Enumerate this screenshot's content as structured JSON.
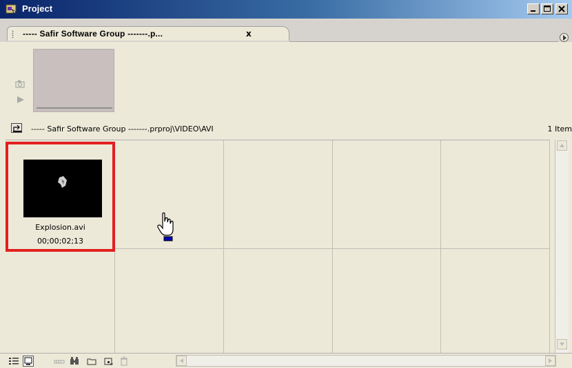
{
  "window": {
    "title": "Project",
    "icons": [
      "app-icon",
      "minimize-icon",
      "maximize-icon",
      "close-icon"
    ]
  },
  "tab": {
    "label": "----- Safir Software Group -------.p...",
    "close": "x"
  },
  "path": {
    "text": "----- Safir Software Group -------.prproj\\VIDEO\\AVI",
    "item_count": "1 Item"
  },
  "clips": [
    {
      "name": "Explosion.avi",
      "duration": "00;00;02;13",
      "selected": true
    }
  ],
  "toolbar": {
    "icons": [
      "list-view-icon",
      "icon-view-icon",
      "automate-to-sequence-icon",
      "find-icon",
      "new-bin-icon",
      "new-item-icon",
      "clear-icon",
      "scroll-left-icon"
    ]
  },
  "colors": {
    "title_gradient_start": "#0a246a",
    "selection_border": "#e21f1f",
    "panel_background": "#ece9d8",
    "preview_background": "#c9bfbf"
  }
}
